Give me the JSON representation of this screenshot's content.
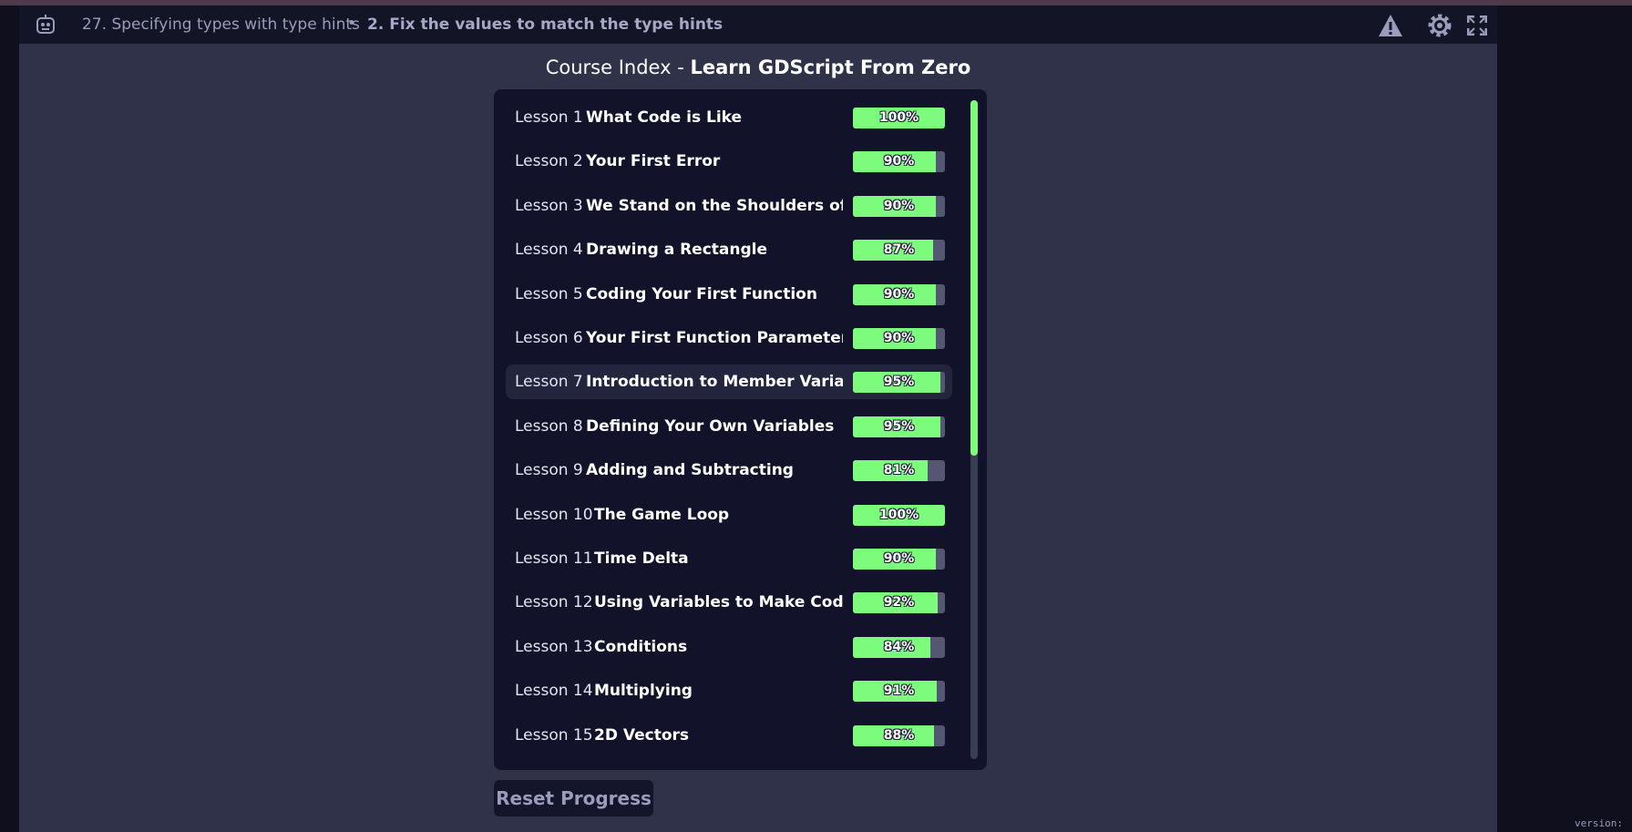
{
  "breadcrumb": {
    "lesson": "27. Specifying types with type hints",
    "separator": "•",
    "practice": "2. Fix the values to match the type hints"
  },
  "icons": {
    "logo": "robot-logo-icon",
    "warning": "warning-icon",
    "settings": "gear-icon",
    "fullscreen": "fullscreen-icon"
  },
  "title": {
    "prefix": "Course Index - ",
    "course": "Learn GDScript From Zero"
  },
  "lessons": [
    {
      "num": "Lesson 1",
      "name": "What Code is Like",
      "progress": 100,
      "pct_label": "100%"
    },
    {
      "num": "Lesson 2",
      "name": "Your First Error",
      "progress": 90,
      "pct_label": "90%"
    },
    {
      "num": "Lesson 3",
      "name": "We Stand on the Shoulders of Giants",
      "progress": 90,
      "pct_label": "90%"
    },
    {
      "num": "Lesson 4",
      "name": "Drawing a Rectangle",
      "progress": 87,
      "pct_label": "87%"
    },
    {
      "num": "Lesson 5",
      "name": "Coding Your First Function",
      "progress": 90,
      "pct_label": "90%"
    },
    {
      "num": "Lesson 6",
      "name": "Your First Function Parameter",
      "progress": 90,
      "pct_label": "90%"
    },
    {
      "num": "Lesson 7",
      "name": "Introduction to Member Variables",
      "progress": 95,
      "pct_label": "95%"
    },
    {
      "num": "Lesson 8",
      "name": "Defining Your Own Variables",
      "progress": 95,
      "pct_label": "95%"
    },
    {
      "num": "Lesson 9",
      "name": "Adding and Subtracting",
      "progress": 81,
      "pct_label": "81%"
    },
    {
      "num": "Lesson 10",
      "name": "The Game Loop",
      "progress": 100,
      "pct_label": "100%"
    },
    {
      "num": "Lesson 11",
      "name": "Time Delta",
      "progress": 90,
      "pct_label": "90%"
    },
    {
      "num": "Lesson 12",
      "name": "Using Variables to Make Code Easier to Read",
      "progress": 92,
      "pct_label": "92%"
    },
    {
      "num": "Lesson 13",
      "name": "Conditions",
      "progress": 84,
      "pct_label": "84%"
    },
    {
      "num": "Lesson 14",
      "name": "Multiplying",
      "progress": 91,
      "pct_label": "91%"
    },
    {
      "num": "Lesson 15",
      "name": "2D Vectors",
      "progress": 88,
      "pct_label": "88%"
    }
  ],
  "highlighted_lesson": 7,
  "reset_button": "Reset Progress",
  "version": "version:",
  "colors": {
    "progress_fill": "#7cfb7c",
    "panel_bg": "#12132a",
    "page_bg": "#30324a"
  }
}
